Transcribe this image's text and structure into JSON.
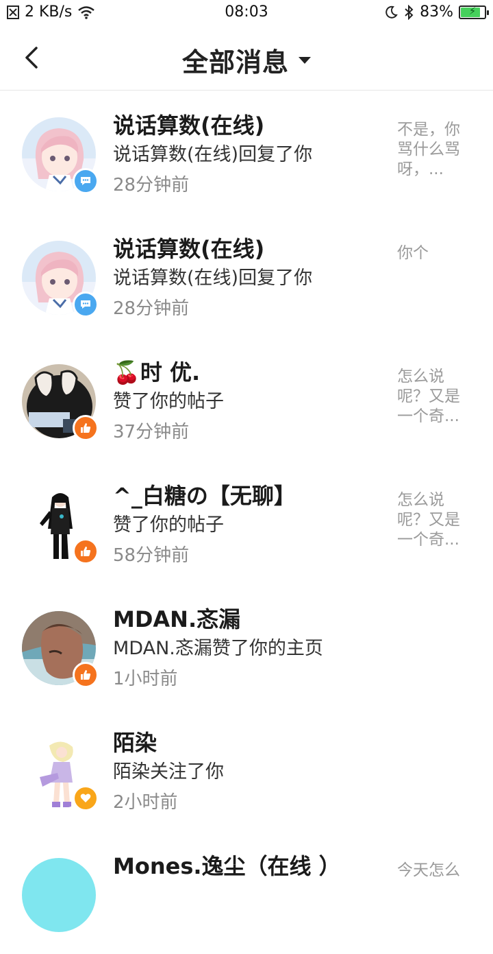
{
  "status_bar": {
    "speed": "2 KB/s",
    "time": "08:03",
    "battery": "83%",
    "battery_level": 0.83,
    "icons": [
      "notification-icon",
      "wifi-icon",
      "moon-icon",
      "bluetooth-icon",
      "battery-icon"
    ]
  },
  "header": {
    "title": "全部消息",
    "back_icon": "chevron-left-icon",
    "dropdown_icon": "caret-down-icon"
  },
  "messages": [
    {
      "name": "说话算数(在线)",
      "action": "说话算数(在线)回复了你",
      "time": "28分钟前",
      "preview": "不是，你骂什么骂呀，...",
      "badge": "comment",
      "badge_color": "#4aa8f0"
    },
    {
      "name": "说话算数(在线)",
      "action": "说话算数(在线)回复了你",
      "time": "28分钟前",
      "preview": "你个",
      "badge": "comment",
      "badge_color": "#4aa8f0"
    },
    {
      "name_emoji": "🍒",
      "name": "时 优.",
      "action": "赞了你的帖子",
      "time": "37分钟前",
      "preview": "怎么说呢？又是一个奇...",
      "badge": "like",
      "badge_color": "#f5731e"
    },
    {
      "name": "^_白糖の【无聊】",
      "action": "赞了你的帖子",
      "time": "58分钟前",
      "preview": "怎么说呢？又是一个奇...",
      "badge": "like",
      "badge_color": "#f5731e"
    },
    {
      "name": "MDAN.忞漏",
      "action": "MDAN.忞漏赞了你的主页",
      "time": "1小时前",
      "preview": "",
      "badge": "like",
      "badge_color": "#f5731e"
    },
    {
      "name": "陌染",
      "action": "陌染关注了你",
      "time": "2小时前",
      "preview": "",
      "badge": "heart",
      "badge_color": "#f9a61a"
    },
    {
      "name": "Mones.逸尘（在线 ）",
      "action": "",
      "time": "",
      "preview": "今天怎么",
      "badge": "",
      "badge_color": ""
    }
  ]
}
